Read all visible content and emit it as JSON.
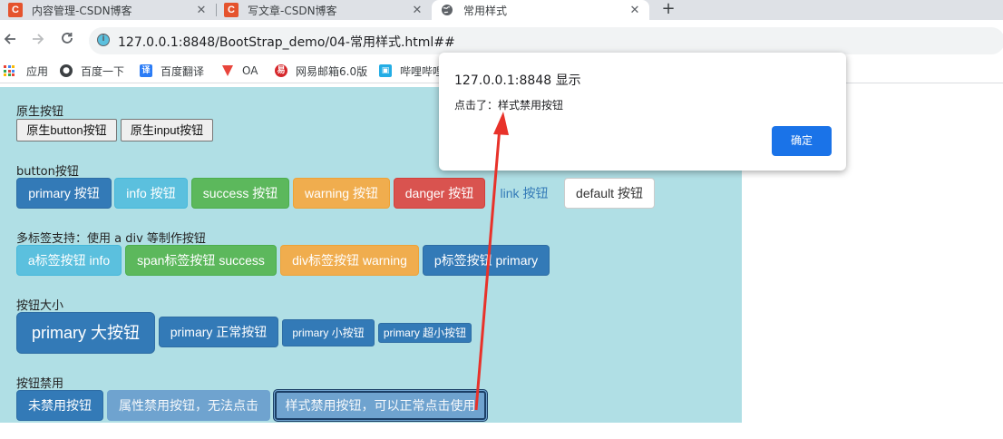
{
  "browser": {
    "tabs": [
      {
        "title": "内容管理-CSDN博客",
        "favicon": "csdn-icon"
      },
      {
        "title": "写文章-CSDN博客",
        "favicon": "csdn-icon"
      },
      {
        "title": "常用样式",
        "favicon": "globe-icon"
      }
    ],
    "close_glyph": "✕",
    "newtab_glyph": "+",
    "url": "127.0.0.1:8848/BootStrap_demo/04-常用样式.html##",
    "bookmarks": [
      {
        "label": "应用",
        "icon": "apps-grid-icon"
      },
      {
        "label": "百度一下",
        "icon": "baidu-icon"
      },
      {
        "label": "百度翻译",
        "icon": "baidu-translate-icon"
      },
      {
        "label": "OA",
        "icon": "oa-icon"
      },
      {
        "label": "网易邮箱6.0版",
        "icon": "netease-mail-icon"
      },
      {
        "label": "哔哩哔哩",
        "icon": "bilibili-icon"
      }
    ]
  },
  "page": {
    "native": {
      "title": "原生按钮",
      "button_label": "原生button按钮",
      "input_value": "原生input按钮"
    },
    "variants": {
      "title": "button按钮",
      "primary": "primary 按钮",
      "info": "info 按钮",
      "success": "success 按钮",
      "warning": "warning 按钮",
      "danger": "danger 按钮",
      "link": "link 按钮",
      "default": "default 按钮"
    },
    "tags": {
      "title": "多标签支持：使用 a div 等制作按钮",
      "a": "a标签按钮 info",
      "span": "span标签按钮 success",
      "div": "div标签按钮 warning",
      "p": "p标签按钮 primary"
    },
    "sizes": {
      "title": "按钮大小",
      "large": "primary 大按钮",
      "normal": "primary 正常按钮",
      "small": "primary 小按钮",
      "xsmall": "primary 超小按钮"
    },
    "disabled": {
      "title": "按钮禁用",
      "enabled": "未禁用按钮",
      "attr_disabled": "属性禁用按钮，无法点击",
      "class_disabled": "样式禁用按钮，可以正常点击使用"
    }
  },
  "dialog": {
    "title": "127.0.0.1:8848 显示",
    "message": "点击了：样式禁用按钮",
    "ok_label": "确定"
  },
  "colors": {
    "page_bg": "#b0dfe5",
    "primary": "#337ab7",
    "info": "#5bc0de",
    "success": "#5cb85c",
    "warning": "#f0ad4e",
    "danger": "#d9534f",
    "dialog_ok": "#1a73e8",
    "annotation_arrow": "#e8322a"
  }
}
